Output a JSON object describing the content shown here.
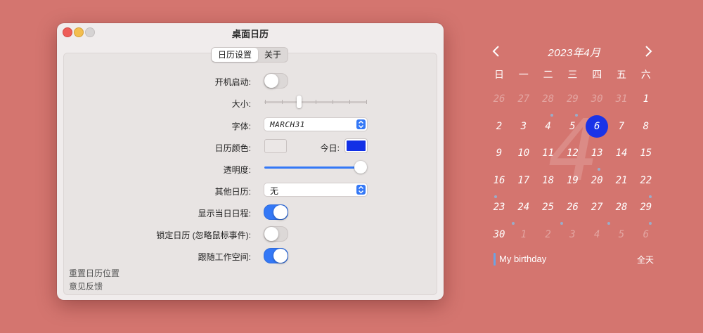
{
  "window": {
    "title": "桌面日历",
    "tabs": [
      {
        "label": "日历设置",
        "active": true
      },
      {
        "label": "关于",
        "active": false
      }
    ],
    "settings": {
      "launch_at_login": {
        "label": "开机启动:",
        "on": false
      },
      "size": {
        "label": "大小:",
        "value_fraction": 0.34
      },
      "font": {
        "label": "字体:",
        "value": "MARCH31"
      },
      "calendar_color": {
        "label": "日历颜色:",
        "color": "#ebe7e6"
      },
      "today_color": {
        "label": "今日:",
        "color": "#1230e6"
      },
      "opacity": {
        "label": "透明度:",
        "value_fraction": 1.0
      },
      "other_calendar": {
        "label": "其他日历:",
        "value": "无"
      },
      "show_today_schedule": {
        "label": "显示当日日程:",
        "on": true
      },
      "lock_calendar": {
        "label": "锁定日历 (忽略鼠标事件):",
        "on": false
      },
      "follow_workspace": {
        "label": "跟随工作空间:",
        "on": true
      }
    },
    "links": {
      "reset_position": "重置日历位置",
      "feedback": "意见反馈"
    }
  },
  "calendar": {
    "title": "2023年4月",
    "prev_icon": "chevron-left-icon",
    "next_icon": "chevron-right-icon",
    "weekdays": [
      "日",
      "一",
      "二",
      "三",
      "四",
      "五",
      "六"
    ],
    "big_month_digit": "4",
    "weeks": [
      [
        "26",
        "27",
        "28",
        "29",
        "30",
        "31",
        "1"
      ],
      [
        "2",
        "3",
        "4",
        "5",
        "6",
        "7",
        "8"
      ],
      [
        "9",
        "10",
        "11",
        "12",
        "13",
        "14",
        "15"
      ],
      [
        "16",
        "17",
        "18",
        "19",
        "20",
        "21",
        "22"
      ],
      [
        "23",
        "24",
        "25",
        "26",
        "27",
        "28",
        "29"
      ],
      [
        "30",
        "1",
        "2",
        "3",
        "4",
        "5",
        "6"
      ]
    ],
    "today": "6",
    "today_color": "#1a33e8",
    "event": {
      "title": "My birthday",
      "time": "全天"
    }
  }
}
